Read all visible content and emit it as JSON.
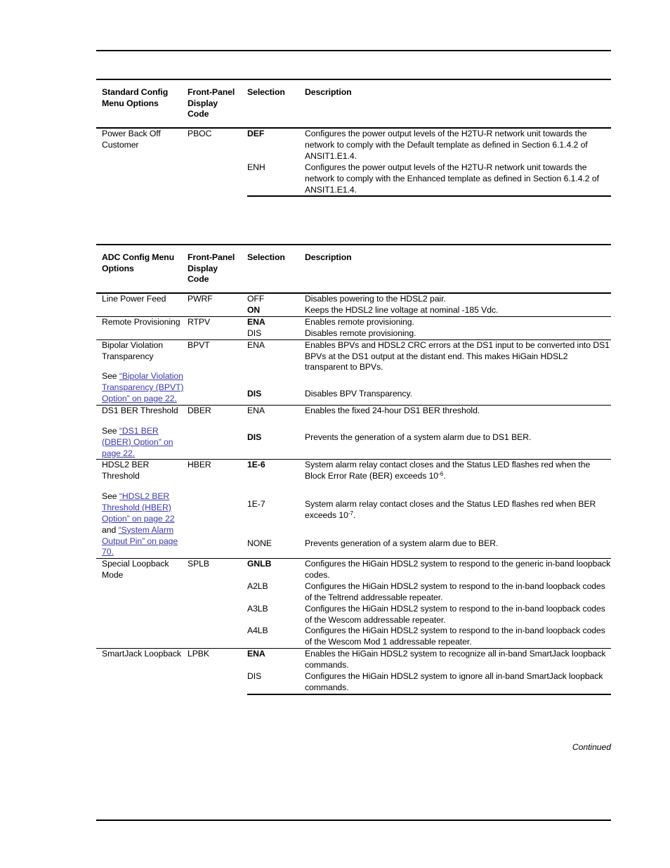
{
  "page": {
    "continued_note": "Continued",
    "link_color": "#3b3ba8",
    "rule_color": "#000000"
  },
  "tables": [
    {
      "id": "standard-config",
      "headers": {
        "col1": [
          "Standard Config",
          "Menu Options"
        ],
        "col2": [
          "Front-Panel",
          "Display",
          "Code"
        ],
        "col3": "Selection",
        "col4": "Description"
      },
      "rows": [
        {
          "option": "Power Back Off Customer",
          "code": "PBOC",
          "selections": [
            {
              "value": "DEF",
              "bold": true,
              "description": "Configures the power output levels of the H2TU-R network unit towards the network to comply with the Default template as defined in Section 6.1.4.2 of ANSIT1.E1.4."
            },
            {
              "value": "ENH",
              "bold": false,
              "description": "Configures the power output levels of the H2TU-R network unit towards the network to comply with the Enhanced template as defined in Section 6.1.4.2 of ANSIT1.E1.4."
            }
          ]
        }
      ]
    },
    {
      "id": "adc-config",
      "headers": {
        "col1": [
          "ADC Config Menu",
          "Options"
        ],
        "col2": [
          "Front-Panel",
          "Display",
          "Code"
        ],
        "col3": "Selection",
        "col4": "Description"
      },
      "rows": [
        {
          "option": "Line Power Feed",
          "code": "PWRF",
          "selections": [
            {
              "value": "OFF",
              "bold": false,
              "description": "Disables powering to the HDSL2 pair."
            },
            {
              "value": "ON",
              "bold": true,
              "description": "Keeps the HDSL2 line voltage at nominal -185 Vdc."
            }
          ]
        },
        {
          "option": "Remote Provisioning",
          "code": "RTPV",
          "selections": [
            {
              "value": "ENA",
              "bold": true,
              "description": "Enables remote provisioning."
            },
            {
              "value": "DIS",
              "bold": false,
              "description": "Disables remote provisioning."
            }
          ]
        },
        {
          "option": "Bipolar Violation Transparency",
          "code": "BPVT",
          "reference": {
            "prefix": "See ",
            "link": "“Bipolar Violation Transparency (BPVT) Option” on page 22.",
            "suffix": ""
          },
          "selections": [
            {
              "value": "ENA",
              "bold": false,
              "description": "Enables BPVs and HDSL2 CRC errors at the DS1 input to be converted into DS1 BPVs at the DS1 output at the distant end. This makes HiGain HDSL2 transparent to BPVs."
            },
            {
              "value": "DIS",
              "bold": true,
              "description": "Disables BPV Transparency."
            }
          ]
        },
        {
          "option": "DS1 BER Threshold",
          "code": "DBER",
          "reference": {
            "prefix": "See ",
            "link": "“DS1 BER (DBER) Option” on page 22.",
            "suffix": ""
          },
          "selections": [
            {
              "value": "ENA",
              "bold": false,
              "description": "Enables the fixed 24-hour DS1 BER threshold."
            },
            {
              "value": "DIS",
              "bold": true,
              "description": "Prevents the generation of a system alarm due to DS1 BER."
            }
          ]
        },
        {
          "option": "HDSL2 BER Threshold",
          "code": "HBER",
          "reference": {
            "prefix": "See ",
            "link": "“HDSL2 BER Threshold (HBER) Option” on page 22",
            "middle": " and ",
            "link2": "“System Alarm Output Pin” on page 70."
          },
          "selections": [
            {
              "value": "1E-6",
              "bold": true,
              "description_pre": "System alarm relay contact closes and the Status LED flashes red when the Block Error Rate (BER) exceeds 10",
              "description_sup": "-6",
              "description_post": "."
            },
            {
              "value": "1E-7",
              "bold": false,
              "description_pre": "System alarm relay contact closes and the Status LED flashes red when BER exceeds 10",
              "description_sup": "-7",
              "description_post": "."
            },
            {
              "value": "NONE",
              "bold": false,
              "description": "Prevents generation of a system alarm due to BER."
            }
          ]
        },
        {
          "option": "Special Loopback Mode",
          "code": "SPLB",
          "selections": [
            {
              "value": "GNLB",
              "bold": true,
              "description": "Configures the HiGain HDSL2 system to respond to the generic in-band loopback codes."
            },
            {
              "value": "A2LB",
              "bold": false,
              "description": "Configures the HiGain HDSL2 system to respond to the in-band loopback codes of the Teltrend addressable repeater."
            },
            {
              "value": "A3LB",
              "bold": false,
              "description": "Configures the HiGain HDSL2 system to respond to the in-band loopback codes of the Wescom addressable repeater."
            },
            {
              "value": "A4LB",
              "bold": false,
              "description": "Configures the HiGain HDSL2 system to respond to the in-band loopback codes of the Wescom Mod 1 addressable repeater."
            }
          ]
        },
        {
          "option": "SmartJack Loopback",
          "code": "LPBK",
          "selections": [
            {
              "value": "ENA",
              "bold": true,
              "description": "Enables the HiGain HDSL2 system to recognize all in-band SmartJack loopback commands."
            },
            {
              "value": "DIS",
              "bold": false,
              "description": "Configures the HiGain HDSL2 system to ignore all in-band SmartJack loopback commands."
            }
          ]
        }
      ]
    }
  ]
}
